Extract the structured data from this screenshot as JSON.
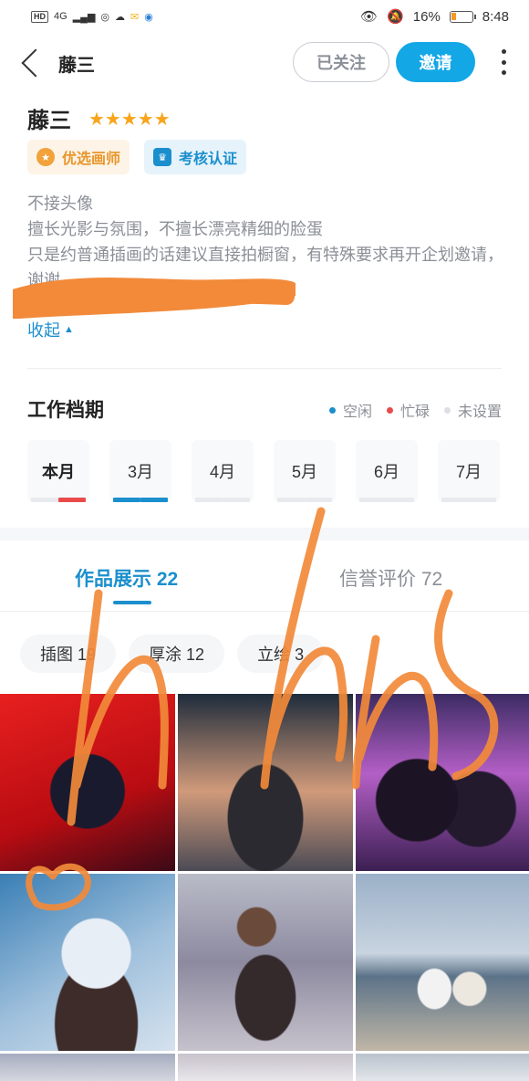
{
  "status_bar": {
    "network": "HD",
    "signal": "4G",
    "battery_percent": "16%",
    "time": "8:48"
  },
  "header": {
    "back_icon": "back-arrow-icon",
    "title": "藤三",
    "followed_label": "已关注",
    "invite_label": "邀请",
    "more_icon": "more-vertical-icon"
  },
  "profile": {
    "name": "藤三",
    "rating": 5,
    "rating_stars": "★★★★★",
    "badges": [
      {
        "label": "优选画师",
        "icon": "star-badge-icon",
        "color": "#e8962a"
      },
      {
        "label": "考核认证",
        "icon": "certified-badge-icon",
        "color": "#1b8fcd"
      }
    ],
    "bio_lines": [
      "不接头像",
      "擅长光影与氛围，不擅长漂亮精细的脸蛋",
      "只是约普通插画的话建议直接拍橱窗，有特殊要求再开企划邀请，谢谢"
    ],
    "collapse_label": "收起"
  },
  "schedule": {
    "title": "工作档期",
    "legend": [
      {
        "label": "空闲",
        "color": "#1b8fcd"
      },
      {
        "label": "忙碌",
        "color": "#e94b4b"
      },
      {
        "label": "未设置",
        "color": "#dcdfe4"
      }
    ],
    "months": [
      {
        "label": "本月",
        "first_half": "unset",
        "second_half": "busy"
      },
      {
        "label": "3月",
        "first_half": "free",
        "second_half": "free"
      },
      {
        "label": "4月",
        "first_half": "unset",
        "second_half": "unset"
      },
      {
        "label": "5月",
        "first_half": "unset",
        "second_half": "unset"
      },
      {
        "label": "6月",
        "first_half": "unset",
        "second_half": "unset"
      },
      {
        "label": "7月",
        "first_half": "unset",
        "second_half": "unset"
      }
    ]
  },
  "tabs": [
    {
      "label": "作品展示 22",
      "active": true
    },
    {
      "label": "信誉评价 72",
      "active": false
    }
  ],
  "filters": [
    {
      "label": "插图 19"
    },
    {
      "label": "厚涂 12"
    },
    {
      "label": "立绘 3"
    }
  ],
  "colors": {
    "accent": "#13a7e6",
    "busy": "#e94b4b",
    "free": "#1b8fcd",
    "star": "#f8a51c",
    "scribble": "#f28a3a"
  }
}
